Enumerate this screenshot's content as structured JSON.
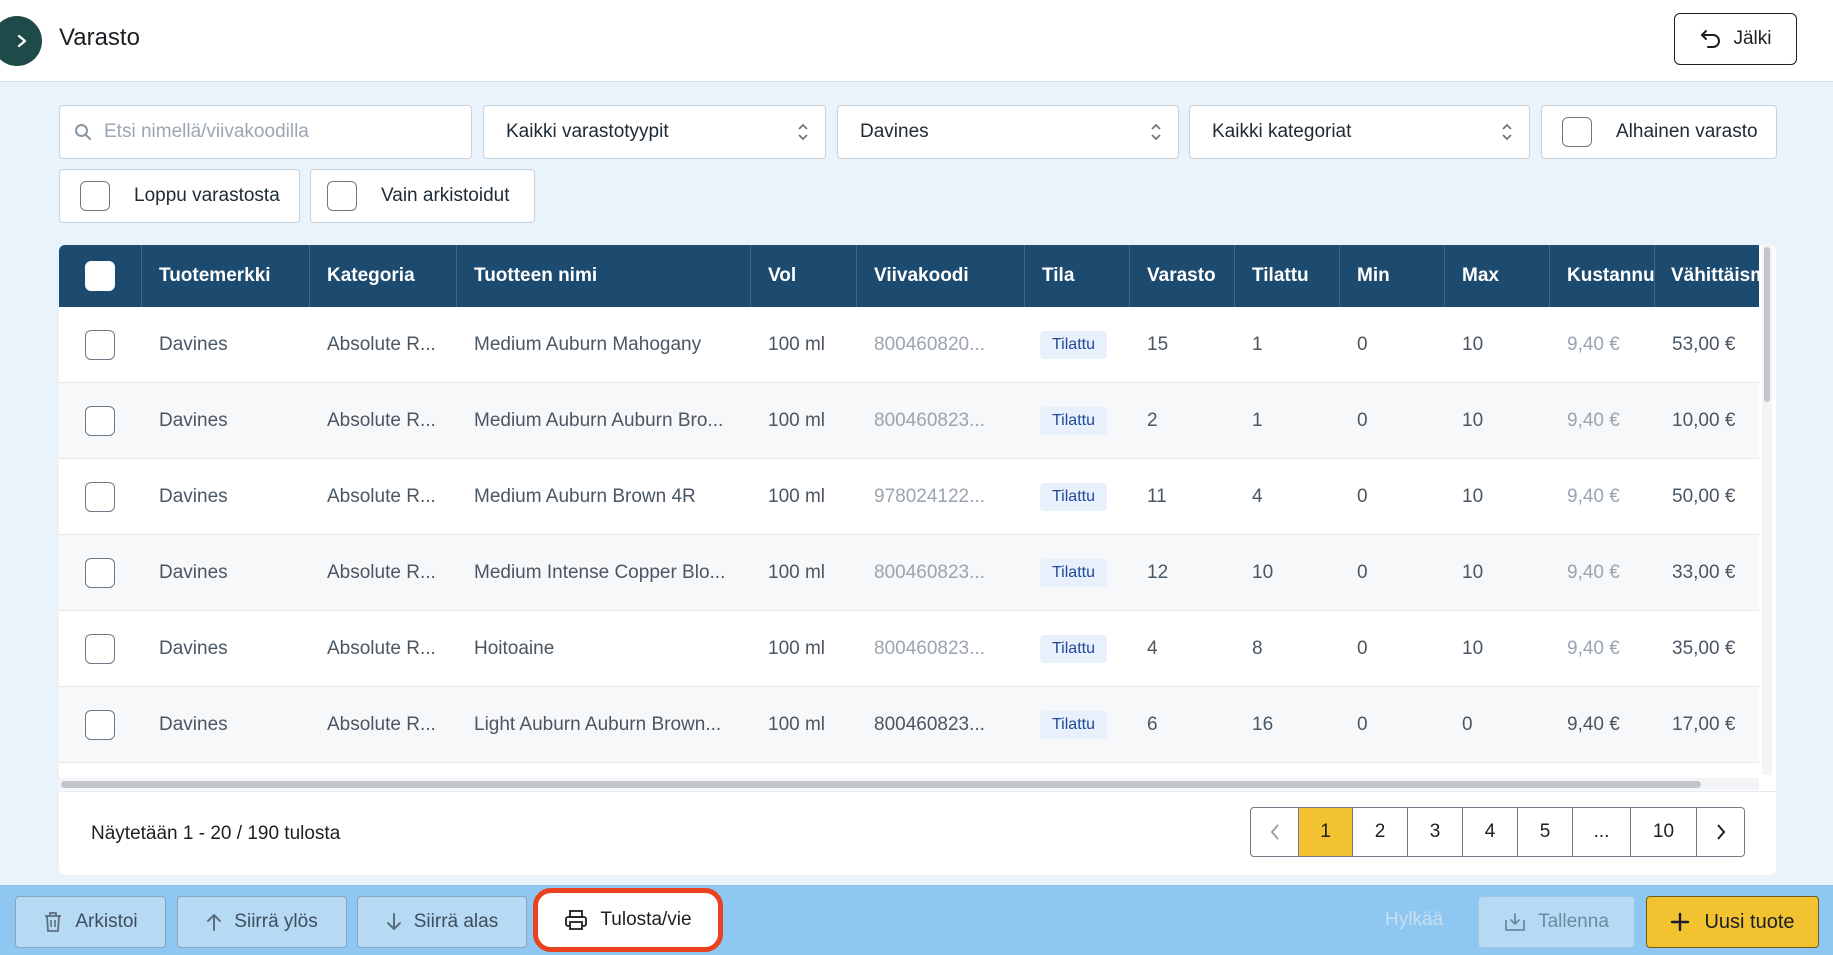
{
  "header": {
    "title": "Varasto",
    "back_label": "Jälki"
  },
  "filters": {
    "search_placeholder": "Etsi nimellä/viivakoodilla",
    "stock_type": "Kaikki varastotyypit",
    "brand": "Davines",
    "category": "Kaikki kategoriat",
    "low_stock": "Alhainen varasto",
    "out_of_stock": "Loppu varastosta",
    "archived_only": "Vain arkistoidut"
  },
  "table": {
    "columns": [
      "Tuotemerkki",
      "Kategoria",
      "Tuotteen nimi",
      "Vol",
      "Viivakoodi",
      "Tila",
      "Varasto",
      "Tilattu",
      "Min",
      "Max",
      "Kustannus",
      "Vähittäism"
    ],
    "rows": [
      {
        "brand": "Davines",
        "category": "Absolute R...",
        "name": "Medium Auburn Mahogany",
        "vol": "100 ml",
        "barcode": "800460820...",
        "status": "Tilattu",
        "stock": "15",
        "ordered": "1",
        "min": "0",
        "max": "10",
        "cost": "9,40 €",
        "retail": "53,00 €"
      },
      {
        "brand": "Davines",
        "category": "Absolute R...",
        "name": "Medium Auburn Auburn Bro...",
        "vol": "100 ml",
        "barcode": "800460823...",
        "status": "Tilattu",
        "stock": "2",
        "ordered": "1",
        "min": "0",
        "max": "10",
        "cost": "9,40 €",
        "retail": "10,00 €"
      },
      {
        "brand": "Davines",
        "category": "Absolute R...",
        "name": "Medium Auburn Brown 4R",
        "vol": "100 ml",
        "barcode": "978024122...",
        "status": "Tilattu",
        "stock": "11",
        "ordered": "4",
        "min": "0",
        "max": "10",
        "cost": "9,40 €",
        "retail": "50,00 €"
      },
      {
        "brand": "Davines",
        "category": "Absolute R...",
        "name": "Medium Intense Copper Blo...",
        "vol": "100 ml",
        "barcode": "800460823...",
        "status": "Tilattu",
        "stock": "12",
        "ordered": "10",
        "min": "0",
        "max": "10",
        "cost": "9,40 €",
        "retail": "33,00 €"
      },
      {
        "brand": "Davines",
        "category": "Absolute R...",
        "name": "Hoitoaine",
        "vol": "100 ml",
        "barcode": "800460823...",
        "status": "Tilattu",
        "stock": "4",
        "ordered": "8",
        "min": "0",
        "max": "10",
        "cost": "9,40 €",
        "retail": "35,00 €"
      },
      {
        "brand": "Davines",
        "category": "Absolute R...",
        "name": "Light Auburn Auburn Brown...",
        "vol": "100 ml",
        "barcode": "800460823...",
        "status": "Tilattu",
        "stock": "6",
        "ordered": "16",
        "min": "0",
        "max": "0",
        "cost": "9,40 €",
        "retail": "17,00 €"
      }
    ]
  },
  "pagination": {
    "range_text": "Näytetään 1 - 20 / 190 tulosta",
    "pages": [
      "1",
      "2",
      "3",
      "4",
      "5",
      "...",
      "10"
    ],
    "current": "1"
  },
  "actions": {
    "archive": "Arkistoi",
    "move_up": "Siirrä ylös",
    "move_down": "Siirrä alas",
    "print_export": "Tulosta/vie",
    "discard": "Hylkää",
    "save": "Tallenna",
    "new_product": "Uusi tuote"
  },
  "colors": {
    "header_bg": "#1d4a6f",
    "accent": "#f2c230",
    "action_bar": "#8ec8f2",
    "highlight": "#e8421e"
  }
}
